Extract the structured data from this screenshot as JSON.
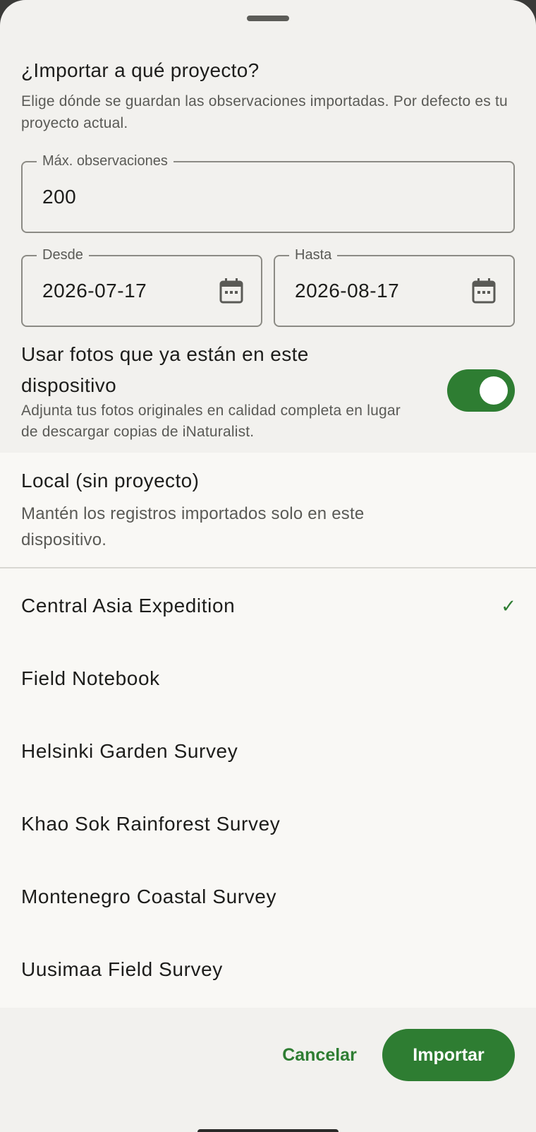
{
  "sheet": {
    "title": "¿Importar a qué proyecto?",
    "subtitle": "Elige dónde se guardan las observaciones importadas. Por defecto es tu proyecto actual."
  },
  "fields": {
    "max": {
      "label": "Máx. observaciones",
      "value": "200"
    },
    "from": {
      "label": "Desde",
      "value": "2026-07-17"
    },
    "to": {
      "label": "Hasta",
      "value": "2026-08-17"
    }
  },
  "toggle": {
    "title": "Usar fotos que ya están en este dispositivo",
    "description": "Adjunta tus fotos originales en calidad completa en lugar de descargar copias de iNaturalist.",
    "enabled": true
  },
  "local": {
    "title": "Local (sin proyecto)",
    "description": "Mantén los registros importados solo en este dispositivo."
  },
  "projects": [
    {
      "name": "Central Asia Expedition",
      "selected": true,
      "check": "✓"
    },
    {
      "name": "Field Notebook",
      "selected": false
    },
    {
      "name": "Helsinki Garden Survey",
      "selected": false
    },
    {
      "name": "Khao Sok Rainforest Survey",
      "selected": false
    },
    {
      "name": "Montenegro Coastal Survey",
      "selected": false
    },
    {
      "name": "Uusimaa Field Survey",
      "selected": false
    }
  ],
  "actions": {
    "cancel": "Cancelar",
    "import": "Importar"
  },
  "colors": {
    "accent": "#2e7d32",
    "sheet_bg": "#f2f1ee",
    "list_bg": "#f9f8f5"
  },
  "icons": {
    "date_picker": "calendar-icon",
    "selected": "check-icon"
  }
}
